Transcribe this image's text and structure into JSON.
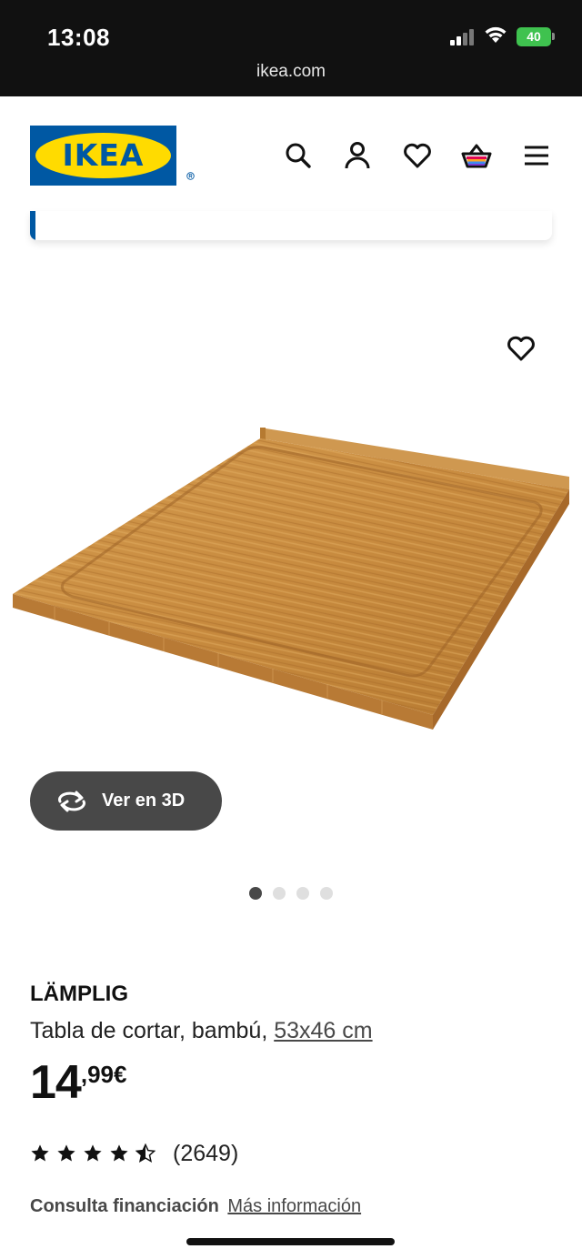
{
  "status_bar": {
    "time": "13:08",
    "battery": "40",
    "url": "ikea.com"
  },
  "header": {
    "logo_text": "IKEA",
    "icons": [
      "search-icon",
      "account-icon",
      "favorites-icon",
      "cart-icon",
      "menu-icon"
    ]
  },
  "colors": {
    "ikea_blue": "#0058a3",
    "ikea_yellow": "#ffdb00",
    "button_dark": "#484848"
  },
  "gallery": {
    "view_3d_label": "Ver en 3D",
    "slide_count": 4,
    "active_slide": 1
  },
  "product": {
    "name": "LÄMPLIG",
    "description": "Tabla de cortar, bambú, ",
    "size": "53x46 cm",
    "price_integer": "14",
    "price_decimal": ",99€",
    "rating": 4.5,
    "review_count": "(2649)"
  },
  "finance": {
    "label": "Consulta financiación",
    "link": "Más información"
  }
}
